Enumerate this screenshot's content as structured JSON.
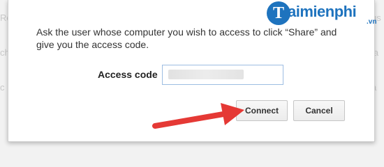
{
  "dialog": {
    "message": "Ask the user whose computer you wish to access to click “Share” and give you the access code.",
    "access_code_label": "Access code",
    "access_code_value": "",
    "connect_label": "Connect",
    "cancel_label": "Cancel"
  },
  "watermark": {
    "logo_letter": "T",
    "brand": "aimienphi",
    "domain": ".vn"
  },
  "background": {
    "left_fragments": [
      "Re",
      "ch",
      "c"
    ],
    "right_fragments": [
      "us",
      "ia",
      "a"
    ]
  },
  "colors": {
    "arrow": "#e53935",
    "watermark": "#1e73be",
    "input_border": "#9dbde2"
  }
}
